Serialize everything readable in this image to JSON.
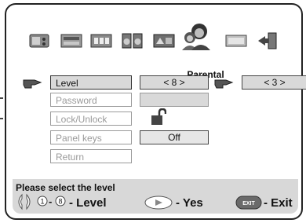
{
  "tabs": [
    {
      "icon": "tv-settings-icon"
    },
    {
      "icon": "screen-icon"
    },
    {
      "icon": "audio-icon"
    },
    {
      "icon": "speaker-icon"
    },
    {
      "icon": "language-icon"
    },
    {
      "icon": "parental-icon",
      "label": "Parental",
      "active": true
    },
    {
      "icon": "display-icon"
    },
    {
      "icon": "exit-door-icon"
    }
  ],
  "menu": {
    "level": {
      "label": "Level",
      "value": "< 8 >",
      "secondary_value": "< 3 >"
    },
    "password": {
      "label": "Password"
    },
    "lock": {
      "label": "Lock/Unlock",
      "icon": "unlocked-padlock-icon"
    },
    "panel_keys": {
      "label": "Panel keys",
      "value": "Off"
    },
    "return": {
      "label": "Return"
    }
  },
  "help": {
    "title": "Please select the level",
    "level_range_start": "1",
    "level_range_end": "8",
    "level_text": "- Level",
    "yes_text": "- Yes",
    "exit_key": "EXIT",
    "exit_text": "- Exit"
  }
}
